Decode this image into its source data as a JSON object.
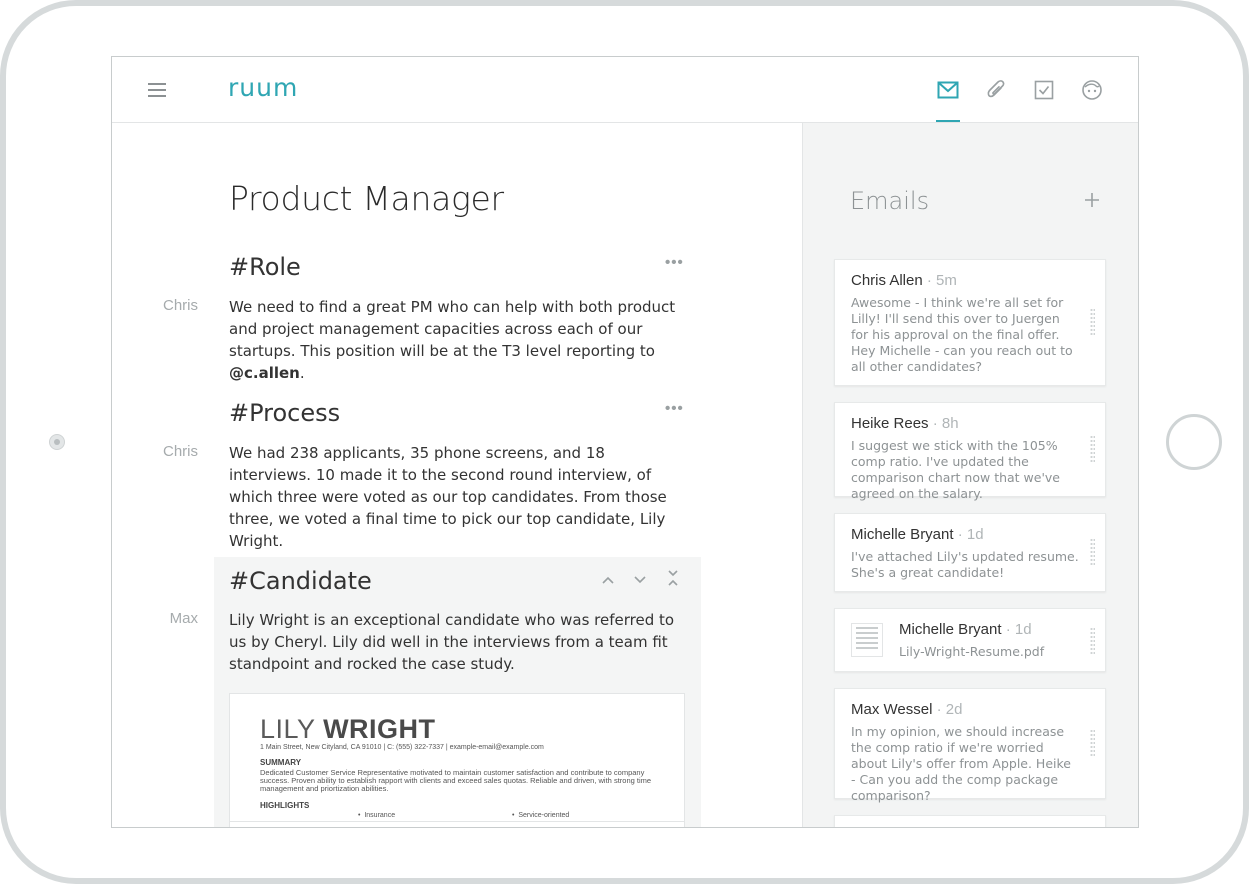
{
  "app": {
    "logo": "ruum",
    "accent_color": "#2fa6b3",
    "nav_icons": [
      "menu-icon",
      "mail-icon",
      "paperclip-icon",
      "checkbox-icon",
      "face-icon"
    ]
  },
  "document": {
    "title": "Product Manager",
    "sections": [
      {
        "heading": "#Role",
        "author": "Chris",
        "body_prefix": "We need to find a great PM who can help with both product and project management capacities across each of our startups.  This position will be at the T3 level reporting to ",
        "mention": "@c.allen",
        "body_suffix": "."
      },
      {
        "heading": "#Process",
        "author": "Chris",
        "body": "We had 238 applicants, 35 phone screens, and 18 interviews.  10 made it to the second round interview, of which three were voted as our top candidates.  From those three, we voted a final time to pick our top candidate, Lily Wright."
      },
      {
        "heading": "#Candidate",
        "author": "Max",
        "body": "Lily Wright is an exceptional candidate who was referred to us by Cheryl.  Lily did well in the interviews from a team fit standpoint and rocked the case study."
      }
    ],
    "resume": {
      "first_name": "LILY ",
      "last_name": "WRIGHT",
      "contact": "1 Main Street, New Cityland, CA 91010  |  C: (555) 322-7337  |  example-email@example.com",
      "summary_label": "SUMMARY",
      "summary": "Dedicated Customer Service Representative motivated to maintain customer satisfaction and contribute to company success. Proven ability to establish rapport with clients and exceed sales quotas. Reliable and driven, with strong time management and priortization abilities.",
      "highlights_label": "HIGHLIGHTS",
      "highlights": [
        "Insurance",
        "Service-oriented"
      ]
    }
  },
  "sidebar": {
    "title": "Emails",
    "emails": [
      {
        "sender": "Chris Allen",
        "time": " · 5m",
        "body": "Awesome - I think we're all set for Lilly! I'll send this over to Juergen for his approval on the final offer.  Hey Michelle - can you reach out to all other candidates?"
      },
      {
        "sender": "Heike Rees",
        "time": " · 8h",
        "body": "I suggest we stick with the 105% comp ratio. I've updated the comparison chart now that we've agreed on the salary."
      },
      {
        "sender": "Michelle Bryant",
        "time": " · 1d",
        "body": "I've attached Lily's updated resume. She's a great candidate!"
      },
      {
        "sender": "Michelle Bryant",
        "time": " · 1d",
        "attachment": "Lily-Wright-Resume.pdf"
      },
      {
        "sender": "Max Wessel",
        "time": " · 2d",
        "body": "In my opinion, we should increase the comp ratio if we're worried about Lily's offer from Apple.  Heike - Can you add the comp package comparison?"
      }
    ]
  }
}
